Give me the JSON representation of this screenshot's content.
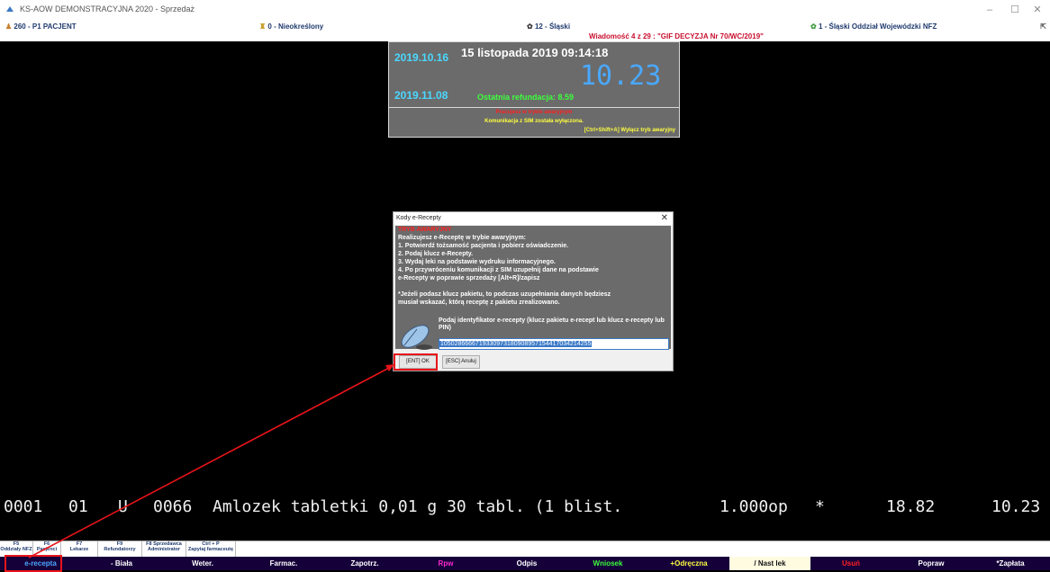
{
  "window": {
    "title": "KS-AOW DEMONSTRACYJNA 2020 - Sprzedaż",
    "minimize": "–",
    "maximize": "☐",
    "close": "✕"
  },
  "infobar": {
    "patient": "260 - P1 PACJENT",
    "doctor": "0 - Nieokreślony",
    "region": "12 - Śląski",
    "message": "Wiadomość 4 z 29 : \"GIF DECYZJA Nr 70/WC/2019\"",
    "nfz": "1 - Śląski Oddział Wojewódzki NFZ",
    "pin": "⇱"
  },
  "datebox": {
    "date1": "2019.10.16",
    "date2": "2019.11.08",
    "datetime": "15 listopada 2019  09:14:18",
    "amount": "10.23",
    "refund": "Ostatnia refundacja: 8.59"
  },
  "warning": {
    "line1": "Pracujesz w trybie awaryjnym",
    "line2": "Komunikacja z SIM została wyłączona.",
    "line3": "[Ctrl+Shift+A] Wyłącz tryb awaryjny"
  },
  "dialog": {
    "title": "Kody e-Recepty",
    "close": "✕",
    "heading": "TRYB AWARYJNY",
    "lines": [
      "Realizujesz e-Receptę w trybie awaryjnym:",
      "  1. Potwierdź tożsamość pacjenta i pobierz oświadczenie.",
      "  2. Podaj klucz e-Recepty.",
      "  3. Wydaj leki na podstawie wydruku informacyjnego.",
      "  4. Po przywróceniu komunikacji z SIM uzupełnij dane na podstawie",
      "e-Recepty w poprawie sprzedaży [Alt+R]/zapisz",
      "",
      "*Jeżeli podasz klucz pakietu, to podczas uzupełniania danych będziesz",
      "musiał wskazać, którą receptę z pakietu zrealizowano."
    ],
    "prompt": "Podaj identyfikator e-recepty (klucz pakietu e-recept lub klucz e-recepty lub PIN)",
    "input_value": "1050286666719330973180908957154417034214255",
    "ok_label": "[ENT] OK",
    "cancel_label": "[ESC] Anuluj"
  },
  "sale_line": {
    "no": "0001",
    "code": "01",
    "type": "U",
    "id": "0066",
    "product": "Amlozek tabletki 0,01 g 30 tabl. (1 blist.",
    "qty": "1.000op",
    "mark": "*",
    "price": "18.82",
    "total": "10.23"
  },
  "fkeys": [
    {
      "key": "F5",
      "label": "Oddziały NFZ"
    },
    {
      "key": "F6",
      "label": "Pacjenci"
    },
    {
      "key": "F7",
      "label": "Lekarze"
    },
    {
      "key": "F9",
      "label": "Refundatorzy"
    },
    {
      "key": "F8 Sprzedawca",
      "label": "Administrator"
    },
    {
      "key": "Ctrl + P",
      "label": "Zapytaj farmaceutę"
    }
  ],
  "bottom_buttons": [
    {
      "label": "e-recepta",
      "color": "#4aa8ff"
    },
    {
      "label": "- Biała",
      "color": "#ffffff"
    },
    {
      "label": "Weter.",
      "color": "#ffffff"
    },
    {
      "label": "Farmac.",
      "color": "#ffffff"
    },
    {
      "label": "Zapotrz.",
      "color": "#ffffff"
    },
    {
      "label": "Rpw",
      "color": "#ff2ad0"
    },
    {
      "label": "Odpis",
      "color": "#ffffff"
    },
    {
      "label": "Wniosek",
      "color": "#3cff3c"
    },
    {
      "label": "+Odręczna",
      "color": "#ffff40"
    },
    {
      "label": "/ Nast lek",
      "color": "#111111",
      "bg": "#fffbe0"
    },
    {
      "label": "Usuń",
      "color": "#ff2020"
    },
    {
      "label": "Popraw",
      "color": "#ffffff"
    },
    {
      "label": "*Zapłata",
      "color": "#ffffff"
    }
  ],
  "colors": {
    "accent_red": "#e8141a",
    "panel_gray": "#6b6b6b",
    "bottom_bg": "#16003a"
  }
}
